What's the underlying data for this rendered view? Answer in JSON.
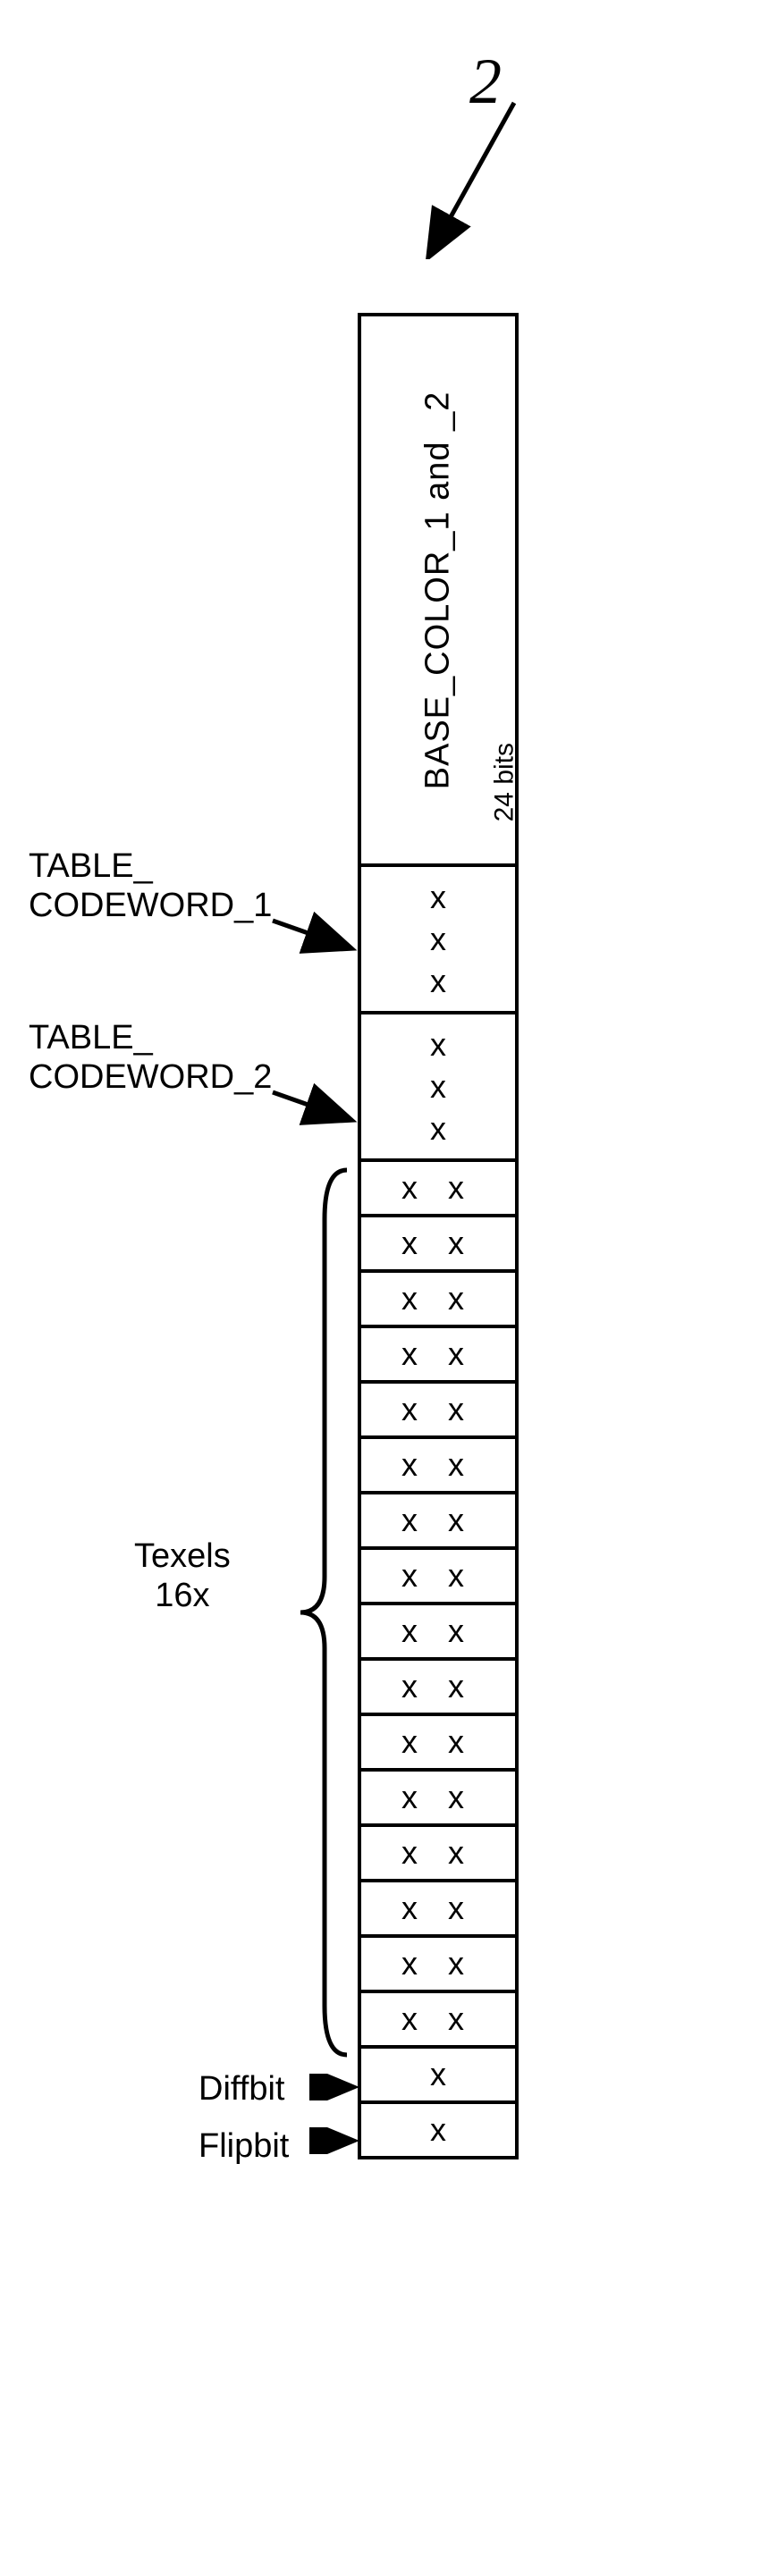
{
  "figure_number": "2",
  "base_color": {
    "label": "BASE_COLOR_1  and  _2",
    "bits": "24 bits"
  },
  "table_codeword_1": {
    "label": "TABLE_\nCODEWORD_1",
    "bits": [
      "x",
      "x",
      "x"
    ]
  },
  "table_codeword_2": {
    "label": "TABLE_\nCODEWORD_2",
    "bits": [
      "x",
      "x",
      "x"
    ]
  },
  "texels": {
    "label": "Texels\n16x",
    "count": 16,
    "cell": "x x"
  },
  "diffbit": {
    "label": "Diffbit",
    "value": "x"
  },
  "flipbit": {
    "label": "Flipbit",
    "value": "x"
  }
}
